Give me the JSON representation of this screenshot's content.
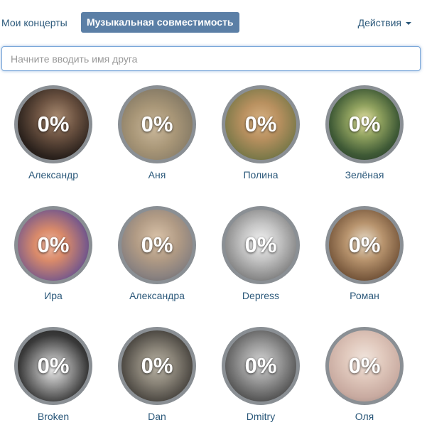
{
  "tabs": {
    "concerts": "Мои концерты",
    "compatibility": "Музыкальная совместимость",
    "actions": "Действия"
  },
  "search": {
    "placeholder": "Начните вводить имя друга"
  },
  "colors": {
    "accent": "#5b7fa6",
    "link": "#2b587a",
    "ring": "#8a8f94"
  },
  "friends": [
    {
      "name": "Александр",
      "percent": "0%",
      "bg": "radial-gradient(circle at 55% 40%, #a88a70 0%, #6a5140 35%, #2a211c 70%, #1a1512 100%)"
    },
    {
      "name": "Аня",
      "percent": "0%",
      "bg": "radial-gradient(circle at 45% 55%, #c9b79a 0%, #a89677 40%, #8a7e68 70%, #6e6a5c 100%)"
    },
    {
      "name": "Полина",
      "percent": "0%",
      "bg": "radial-gradient(circle at 50% 45%, #d8b283 0%, #b8905f 35%, #7e7a4a 70%, #4f5432 100%)"
    },
    {
      "name": "Зелёная",
      "percent": "0%",
      "bg": "radial-gradient(circle at 50% 45%, #e6e2a4 0%, #8fa15e 30%, #3f5a36 65%, #1f2d24 100%)"
    },
    {
      "name": "Ира",
      "percent": "0%",
      "bg": "radial-gradient(circle at 45% 50%, #f0b8a0 0%, #d98a6a 30%, #7a5a8a 70%, #3a3f66 100%)"
    },
    {
      "name": "Александра",
      "percent": "0%",
      "bg": "radial-gradient(circle at 50% 40%, #d9c2a8 0%, #b09a84 40%, #8a8280 70%, #5c5c66 100%)"
    },
    {
      "name": "Depress",
      "percent": "0%",
      "bg": "radial-gradient(circle at 50% 45%, #f2f2f2 0%, #c4c4c4 35%, #8a8a8a 70%, #4a4a4a 100%)"
    },
    {
      "name": "Роман",
      "percent": "0%",
      "bg": "radial-gradient(circle at 50% 45%, #e8dcc8 0%, #b8946e 35%, #7a5a3e 70%, #3e2c20 100%)"
    },
    {
      "name": "Broken",
      "percent": "0%",
      "bg": "radial-gradient(circle at 50% 55%, #e8e8e8 0%, #9a9a9a 30%, #3a3a3a 65%, #151515 100%)"
    },
    {
      "name": "Dan",
      "percent": "0%",
      "bg": "radial-gradient(circle at 50% 50%, #b8b2a4 0%, #8a8478 35%, #4e4a44 70%, #2a2824 100%)"
    },
    {
      "name": "Dmitry",
      "percent": "0%",
      "bg": "radial-gradient(circle at 50% 45%, #d2d2d2 0%, #9a9a9a 35%, #5a5a5a 70%, #2e2e2e 100%)"
    },
    {
      "name": "Оля",
      "percent": "0%",
      "bg": "radial-gradient(circle at 50% 40%, #f0e4dc 0%, #e0c8bc 35%, #c8aaa0 70%, #8e7e78 100%)"
    }
  ]
}
